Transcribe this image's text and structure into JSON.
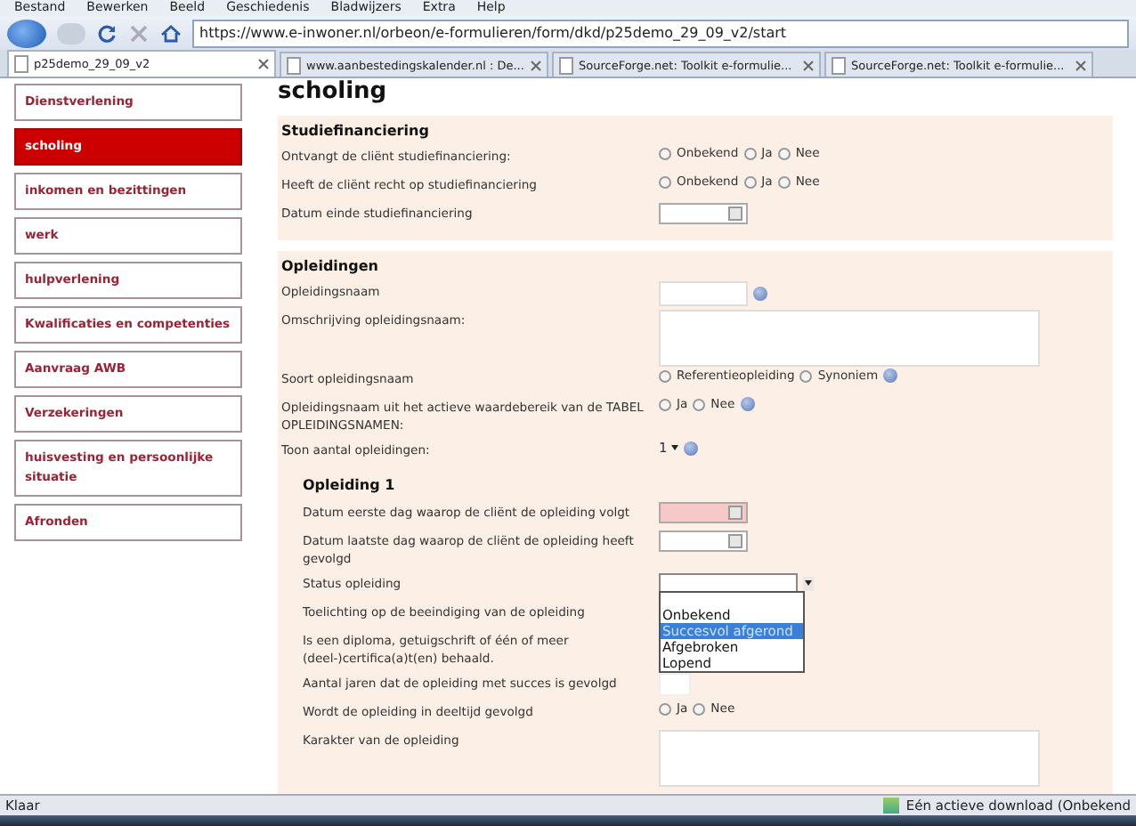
{
  "menu": [
    "Bestand",
    "Bewerken",
    "Beeld",
    "Geschiedenis",
    "Bladwijzers",
    "Extra",
    "Help"
  ],
  "address": "https://www.e-inwoner.nl/orbeon/e-formulieren/form/dkd/p25demo_29_09_v2/start",
  "tabs": [
    {
      "label": "p25demo_29_09_v2",
      "selected": true
    },
    {
      "label": "www.aanbestedingskalender.nl : De...",
      "selected": false
    },
    {
      "label": "SourceForge.net: Toolkit e-formulie...",
      "selected": false
    },
    {
      "label": "SourceForge.net: Toolkit e-formulie...",
      "selected": false
    }
  ],
  "sidebar": [
    {
      "label": "Dienstverlening",
      "selected": false
    },
    {
      "label": "scholing",
      "selected": true
    },
    {
      "label": "inkomen en bezittingen",
      "selected": false
    },
    {
      "label": "werk",
      "selected": false
    },
    {
      "label": "hulpverlening",
      "selected": false
    },
    {
      "label": "Kwalificaties en competenties",
      "selected": false
    },
    {
      "label": "Aanvraag AWB",
      "selected": false
    },
    {
      "label": "Verzekeringen",
      "selected": false
    },
    {
      "label": "huisvesting en persoonlijke situatie",
      "selected": false
    },
    {
      "label": "Afronden",
      "selected": false
    }
  ],
  "page_title": "scholing",
  "sections": [
    {
      "title": "Studiefinanciering",
      "rows": [
        {
          "kind": "radio",
          "label": "Ontvangt de cliënt studiefinanciering:",
          "options": [
            {
              "label": "Onbekend",
              "selected": false
            },
            {
              "label": "Ja",
              "selected": false
            },
            {
              "label": "Nee",
              "selected": false
            }
          ]
        },
        {
          "kind": "radio",
          "label": "Heeft de cliënt recht op studiefinanciering",
          "options": [
            {
              "label": "Onbekend",
              "selected": false
            },
            {
              "label": "Ja",
              "selected": false
            },
            {
              "label": "Nee",
              "selected": false
            }
          ]
        },
        {
          "kind": "date",
          "label": "Datum einde studiefinanciering",
          "invalid": false
        }
      ]
    },
    {
      "title": "Opleidingen",
      "rows": [
        {
          "kind": "text",
          "label": "Opleidingsnaam",
          "help": true
        },
        {
          "kind": "textarea",
          "label": "Omschrijving opleidingsnaam:"
        },
        {
          "kind": "radio",
          "label": "Soort opleidingsnaam",
          "help": true,
          "options": [
            {
              "label": "Referentieopleiding",
              "selected": false
            },
            {
              "label": "Synoniem",
              "selected": false
            }
          ]
        },
        {
          "kind": "radio",
          "label": "Opleidingsnaam uit het actieve waardebereik van de TABEL OPLEIDINGSNAMEN:",
          "help": true,
          "options": [
            {
              "label": "Ja",
              "selected": false
            },
            {
              "label": "Nee",
              "selected": false
            }
          ]
        },
        {
          "kind": "select",
          "label": "Toon aantal opleidingen:",
          "value": "1",
          "help": true
        }
      ],
      "subsection": {
        "title": "Opleiding 1",
        "rows": [
          {
            "kind": "date",
            "label": "Datum eerste dag waarop de cliënt de opleiding volgt",
            "invalid": true
          },
          {
            "kind": "date",
            "label": "Datum laatste dag waarop de cliënt de opleiding heeft gevolgd",
            "invalid": false
          },
          {
            "kind": "dropdown",
            "label": "Status opleiding",
            "options": [
              {
                "label": "Onbekend",
                "selected": false
              },
              {
                "label": "Succesvol afgerond",
                "selected": true
              },
              {
                "label": "Afgebroken",
                "selected": false
              },
              {
                "label": "Lopend",
                "selected": false
              }
            ]
          },
          {
            "kind": "none",
            "label": "Toelichting op de beeindiging van de opleiding"
          },
          {
            "kind": "none",
            "label": "Is een diploma, getuigschrift of één of meer (deel-)certifica(a)t(en) behaald."
          },
          {
            "kind": "small",
            "label": "Aantal jaren dat de opleiding met succes is gevolgd"
          },
          {
            "kind": "radio",
            "label": "Wordt de opleiding in deeltijd gevolgd",
            "options": [
              {
                "label": "Ja",
                "selected": false
              },
              {
                "label": "Nee",
                "selected": false
              }
            ]
          },
          {
            "kind": "textarea",
            "label": "Karakter van de opleiding"
          }
        ]
      }
    }
  ],
  "status_bar": {
    "text": "Klaar",
    "download": "Eén actieve download (Onbekend"
  }
}
